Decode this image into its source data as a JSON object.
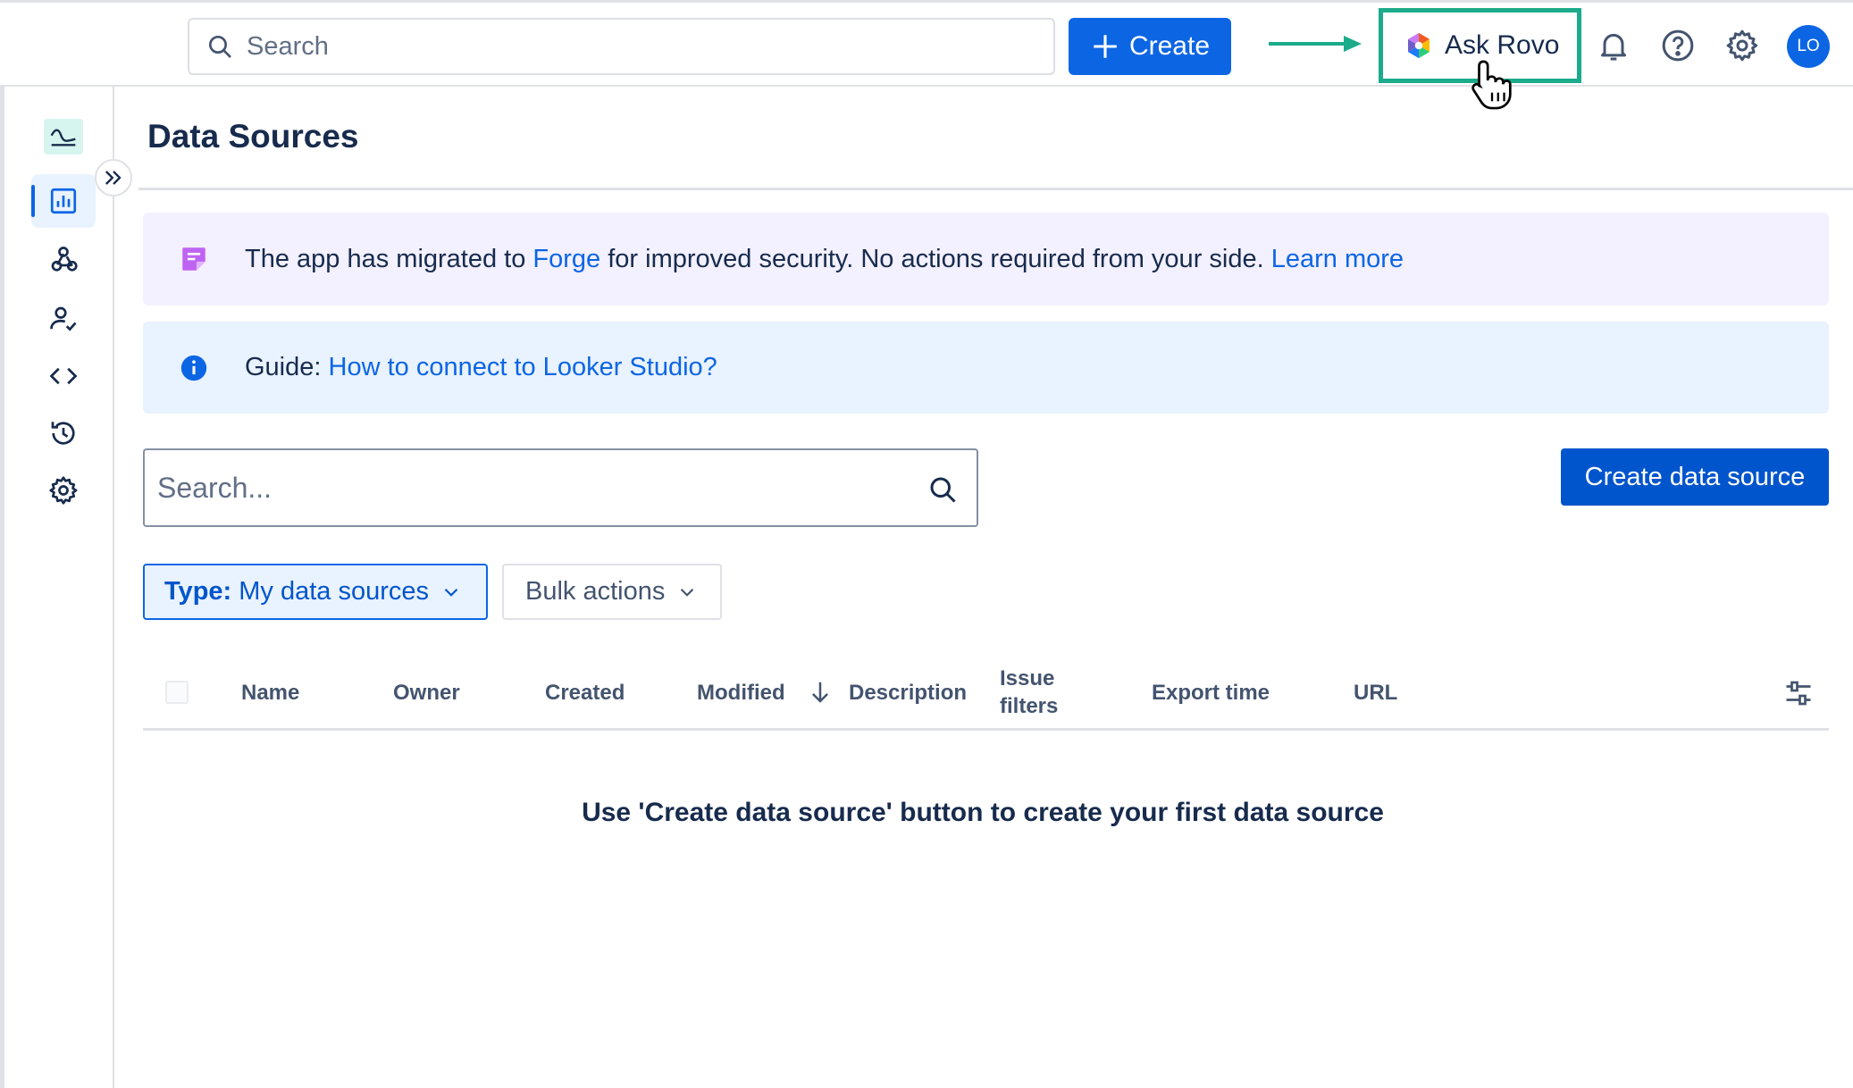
{
  "topbar": {
    "search_placeholder": "Search",
    "create_label": "Create",
    "ask_rovo_label": "Ask Rovo",
    "avatar_initials": "LO",
    "highlight_color": "#1cab8b"
  },
  "sidebar": {
    "expand_icon": "chevrons-right-icon",
    "items": [
      {
        "icon": "app-logo-icon"
      },
      {
        "icon": "chart-icon",
        "active": true
      },
      {
        "icon": "webhook-icon"
      },
      {
        "icon": "user-check-icon"
      },
      {
        "icon": "code-icon"
      },
      {
        "icon": "history-icon"
      },
      {
        "icon": "gear-icon"
      }
    ]
  },
  "page": {
    "title": "Data Sources"
  },
  "banners": {
    "migration": {
      "text_before": "The app has migrated to ",
      "link_forge": "Forge",
      "text_after": " for improved security. No actions required from your side. ",
      "link_learn": "Learn more"
    },
    "guide": {
      "prefix": "Guide: ",
      "link": "How to connect to Looker Studio?"
    }
  },
  "toolbar": {
    "search_placeholder": "Search...",
    "create_data_source_label": "Create data source",
    "type_filter_key": "Type:",
    "type_filter_value": " My data sources",
    "bulk_actions_label": "Bulk actions"
  },
  "table": {
    "columns": [
      "Name",
      "Owner",
      "Created",
      "Modified",
      "Description",
      "Issue filters",
      "Export time",
      "URL"
    ],
    "issue_filters_line1": "Issue",
    "issue_filters_line2": "filters",
    "empty_message": "Use 'Create data source' button to create your first data source"
  }
}
